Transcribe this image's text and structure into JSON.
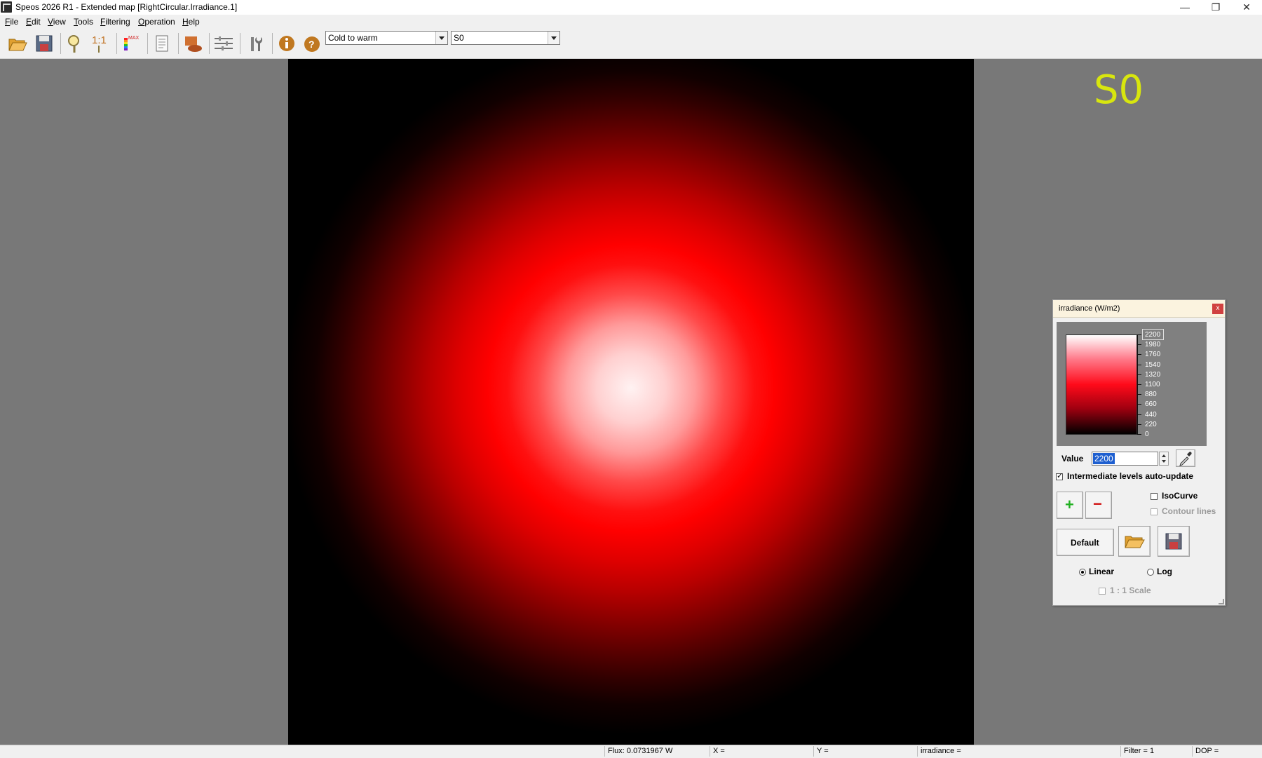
{
  "window": {
    "title": "Speos 2026 R1 - Extended map [RightCircular.Irradiance.1]",
    "minimize_glyph": "—",
    "restore_glyph": "❐",
    "close_glyph": "✕"
  },
  "menu": {
    "items": [
      {
        "accel": "F",
        "rest": "ile"
      },
      {
        "accel": "E",
        "rest": "dit"
      },
      {
        "accel": "V",
        "rest": "iew"
      },
      {
        "accel": "T",
        "rest": "ools"
      },
      {
        "accel": "F",
        "rest": "iltering"
      },
      {
        "accel": "O",
        "rest": "peration"
      },
      {
        "accel": "H",
        "rest": "elp"
      }
    ]
  },
  "toolbar": {
    "palette_combo": "Cold to warm",
    "layer_combo": "S0",
    "zoom_1to1_label": "1:1",
    "scale_max_label": "MAX",
    "icons": [
      "open-folder-icon",
      "save-icon",
      "zoom-icon",
      "zoom-1to1-icon",
      "color-scale-icon",
      "report-icon",
      "surface-icon",
      "settings-sliders-icon",
      "tools-icon",
      "info-icon",
      "help-icon"
    ]
  },
  "map": {
    "layer_label": "S0"
  },
  "status": {
    "flux": "Flux: 0.0731967 W",
    "x": "X =",
    "y": "Y =",
    "irradiance": "irradiance =",
    "filter": "Filter = 1",
    "dop": "DOP ="
  },
  "palette": {
    "title": "irradiance (W/m2)",
    "close_label": "x",
    "scale_labels": [
      "2200",
      "1980",
      "1760",
      "1540",
      "1320",
      "1100",
      "880",
      "660",
      "440",
      "220",
      "0"
    ],
    "value_label": "Value",
    "value": "2200",
    "auto_update_label": "Intermediate levels auto-update",
    "auto_update_checked": true,
    "add_label": "+",
    "remove_label": "−",
    "isocurve_label": "IsoCurve",
    "contour_label": "Contour lines",
    "default_label": "Default",
    "linear_label": "Linear",
    "log_label": "Log",
    "scale_1to1_label": "1 : 1 Scale",
    "linear_selected": true,
    "colors": {
      "add": "#22b022",
      "remove": "#d01010"
    }
  }
}
